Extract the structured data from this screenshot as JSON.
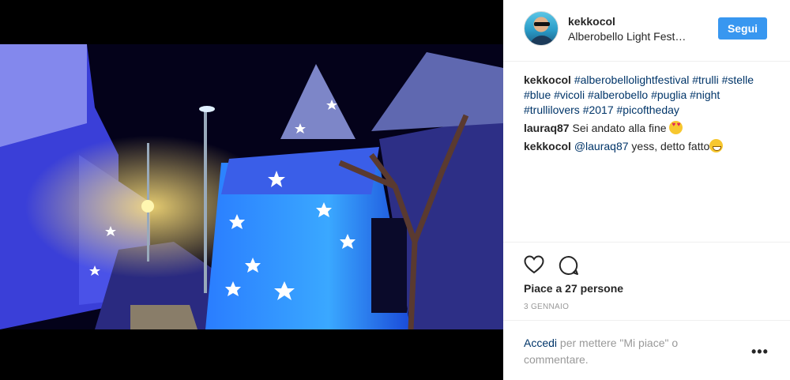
{
  "post": {
    "username": "kekkocol",
    "location": "Alberobello Light Fest…",
    "follow_label": "Segui"
  },
  "comments": [
    {
      "user": "kekkocol",
      "text": "#alberobellolightfestival #trulli #stelle #blue #vicoli #alberobello #puglia #night #trullilovers #2017 #picoftheday"
    },
    {
      "user": "lauraq87",
      "text": "Sei andato alla fine",
      "emoji": "heart-eyes-emoji"
    },
    {
      "user": "kekkocol",
      "mention": "@lauraq87",
      "text": " yess, detto fatto",
      "emoji": "grinning-emoji"
    }
  ],
  "actions": {
    "like_icon": "heart-icon",
    "comment_icon": "comment-icon",
    "likes_text": "Piace a 27 persone",
    "date": "3 GENNAIO"
  },
  "footer": {
    "login_link": "Accedi",
    "login_rest": " per mettere \"Mi piace\" o commentare.",
    "more_label": "•••"
  },
  "colors": {
    "accent": "#3897f0",
    "link": "#003569",
    "text": "#262626",
    "muted": "#999999"
  }
}
